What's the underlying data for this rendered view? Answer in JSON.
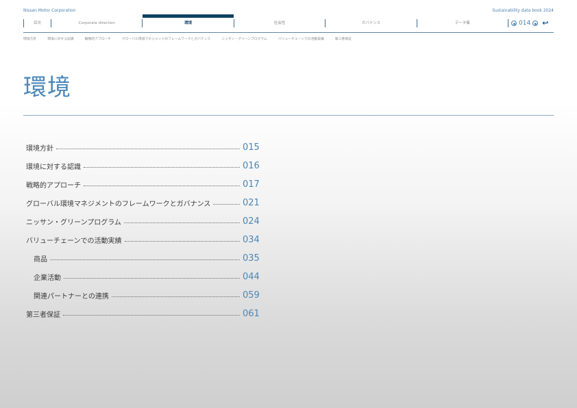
{
  "header": {
    "brand": "Nissan Motor Corporation",
    "report_title": "Sustainability data book 2024"
  },
  "nav": {
    "items": [
      "目次",
      "Corporate direction",
      "環境",
      "社会性",
      "ガバナンス",
      "データ集"
    ],
    "active": "環境"
  },
  "pager": {
    "page": "014"
  },
  "subnav": [
    "環境方針",
    "環境に対する認識",
    "戦略的アプローチ",
    "グローバル環境マネジメントのフレームワークとガバナンス",
    "ニッサン・グリーンプログラム",
    "バリューチェーンでの活動実績",
    "第三者保証"
  ],
  "page_title": "環境",
  "toc": [
    {
      "label": "環境方針",
      "page": "015",
      "indent": false
    },
    {
      "label": "環境に対する認識",
      "page": "016",
      "indent": false
    },
    {
      "label": "戦略的アプローチ",
      "page": "017",
      "indent": false
    },
    {
      "label": "グローバル環境マネジメントのフレームワークとガバナンス",
      "page": "021",
      "indent": false
    },
    {
      "label": "ニッサン・グリーンプログラム",
      "page": "024",
      "indent": false
    },
    {
      "label": "バリューチェーンでの活動実績",
      "page": "034",
      "indent": false
    },
    {
      "label": "商品",
      "page": "035",
      "indent": true
    },
    {
      "label": "企業活動",
      "page": "044",
      "indent": true
    },
    {
      "label": "関連パートナーとの連携",
      "page": "059",
      "indent": true
    },
    {
      "label": "第三者保証",
      "page": "061",
      "indent": false
    }
  ],
  "colors": {
    "accent": "#4a86b8",
    "nav_active": "#0f4261"
  },
  "icons": {
    "prev": "prev-page-icon",
    "next": "next-page-icon",
    "back": "return-icon"
  }
}
